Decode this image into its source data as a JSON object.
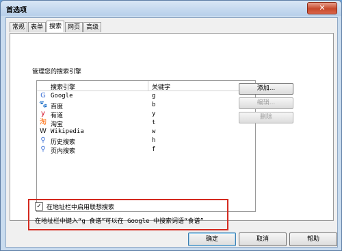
{
  "window": {
    "title": "首选项",
    "close_label": "✕"
  },
  "tabs": [
    {
      "label": "常规",
      "active": false
    },
    {
      "label": "表单",
      "active": false
    },
    {
      "label": "搜索",
      "active": true
    },
    {
      "label": "网页",
      "active": false
    },
    {
      "label": "高级",
      "active": false
    }
  ],
  "section": {
    "label": "管理您的搜索引擎"
  },
  "list": {
    "headers": {
      "engine": "搜索引擎",
      "keyword": "关键字"
    },
    "rows": [
      {
        "name": "Google",
        "keyword": "g",
        "icon": "google-icon",
        "glyph": "G",
        "color": "#3b6fd6"
      },
      {
        "name": "百度",
        "keyword": "b",
        "icon": "baidu-paw-icon",
        "glyph": "🐾",
        "color": "#2a4fb8"
      },
      {
        "name": "有道",
        "keyword": "y",
        "icon": "youdao-icon",
        "glyph": "y",
        "color": "#d0021b"
      },
      {
        "name": "淘宝",
        "keyword": "t",
        "icon": "taobao-icon",
        "glyph": "淘",
        "color": "#ff6600"
      },
      {
        "name": "Wikipedia",
        "keyword": "w",
        "icon": "wikipedia-icon",
        "glyph": "W",
        "color": "#222222"
      },
      {
        "name": "历史搜索",
        "keyword": "h",
        "icon": "magnifier-icon",
        "glyph": "⚲",
        "color": "#3b6fd6"
      },
      {
        "name": "页内搜索",
        "keyword": "f",
        "icon": "magnifier-icon",
        "glyph": "⚲",
        "color": "#3b6fd6"
      }
    ]
  },
  "side_buttons": {
    "add": "添加...",
    "edit": "编辑...",
    "delete": "删除"
  },
  "suggest": {
    "checked": true,
    "check_mark": "✓",
    "label": "在地址栏中启用联想搜索",
    "hint": "在地址栏中键入“g 食谱”可以在 Google 中搜索词语“食谱”"
  },
  "footer": {
    "ok": "确定",
    "cancel": "取消",
    "help": "帮助"
  }
}
